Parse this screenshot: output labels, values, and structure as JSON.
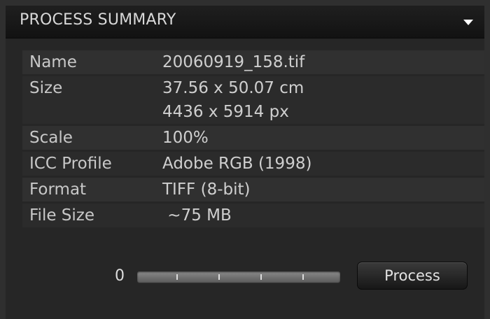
{
  "panel": {
    "title": "PROCESS SUMMARY",
    "toggle_icon": "triangle-down-icon"
  },
  "summary": {
    "rows": [
      {
        "label": "Name",
        "values": [
          "20060919_158.tif"
        ]
      },
      {
        "label": "Size",
        "values": [
          "37.56 x 50.07 cm",
          "4436 x 5914 px"
        ]
      },
      {
        "label": "Scale",
        "values": [
          "100%"
        ]
      },
      {
        "label": "ICC Profile",
        "values": [
          "Adobe RGB (1998)"
        ]
      },
      {
        "label": "Format",
        "values": [
          "TIFF (8-bit)"
        ]
      },
      {
        "label": "File Size",
        "values": [
          " ~75 MB"
        ]
      }
    ]
  },
  "progress": {
    "count": "0",
    "fraction": 0
  },
  "actions": {
    "process_label": "Process"
  },
  "colors": {
    "panel_bg": "#262626",
    "header_bg": "#141414",
    "text": "#cfcfcf"
  }
}
